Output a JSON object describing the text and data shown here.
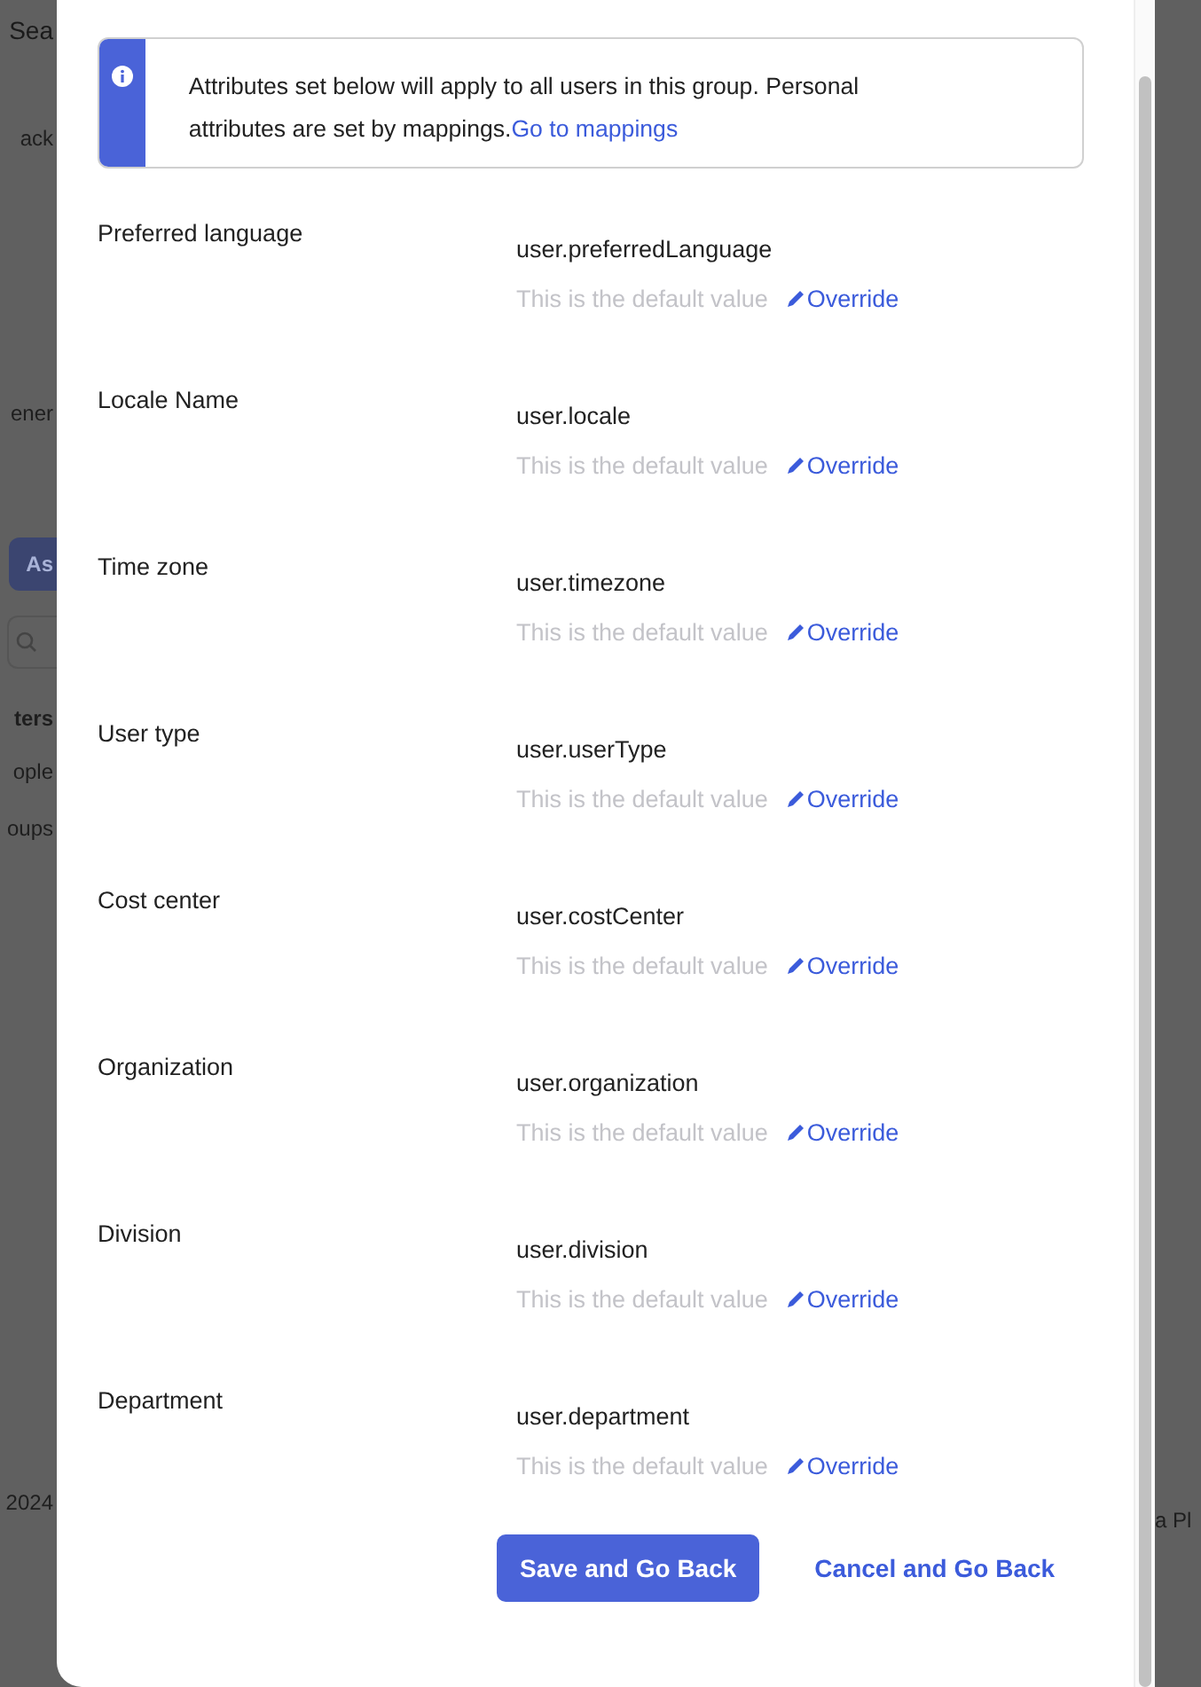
{
  "backdrop": {
    "left_texts": [
      {
        "text": "Sea",
        "kind": "field"
      },
      {
        "text": "ack",
        "kind": "text"
      },
      {
        "text": "ener",
        "kind": "text"
      },
      {
        "text": "As",
        "kind": "button"
      },
      {
        "kind": "search"
      },
      {
        "text": "ters",
        "kind": "heading"
      },
      {
        "text": "ople",
        "kind": "text"
      },
      {
        "text": "oups",
        "kind": "text"
      },
      {
        "text": "2024",
        "kind": "footer"
      }
    ],
    "right_texts": [
      {
        "text": "a Pl"
      }
    ]
  },
  "notice": {
    "text": "Attributes set below will apply to all users in this group. Personal attributes are set by mappings.",
    "link": "Go to mappings"
  },
  "attributes": [
    {
      "label": "Preferred language",
      "value": "user.preferredLanguage",
      "hint": "This is the default value",
      "action": "Override"
    },
    {
      "label": "Locale Name",
      "value": "user.locale",
      "hint": "This is the default value",
      "action": "Override"
    },
    {
      "label": "Time zone",
      "value": "user.timezone",
      "hint": "This is the default value",
      "action": "Override"
    },
    {
      "label": "User type",
      "value": "user.userType",
      "hint": "This is the default value",
      "action": "Override"
    },
    {
      "label": "Cost center",
      "value": "user.costCenter",
      "hint": "This is the default value",
      "action": "Override"
    },
    {
      "label": "Organization",
      "value": "user.organization",
      "hint": "This is the default value",
      "action": "Override"
    },
    {
      "label": "Division",
      "value": "user.division",
      "hint": "This is the default value",
      "action": "Override"
    },
    {
      "label": "Department",
      "value": "user.department",
      "hint": "This is the default value",
      "action": "Override"
    }
  ],
  "buttons": {
    "primary": "Save and Go Back",
    "secondary": "Cancel and Go Back"
  }
}
